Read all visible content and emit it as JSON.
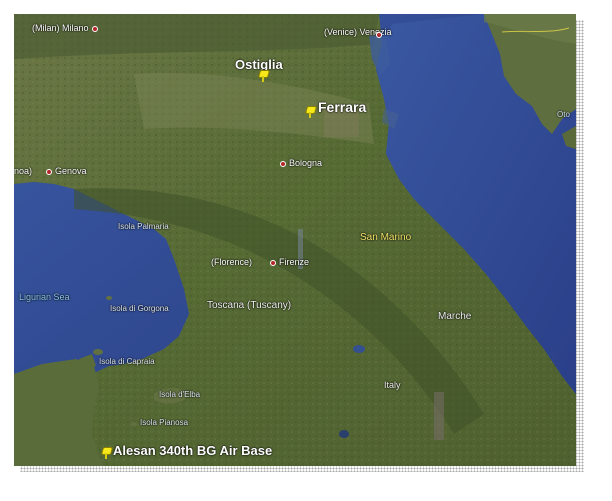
{
  "labels": {
    "milan": "(Milan)  Milano",
    "venice": "(Venice)  Venezia",
    "ostiglia": "Ostiglia",
    "ferrara": "Ferrara",
    "genova_prefix": "noa)",
    "genova": "Genova",
    "bologna": "Bologna",
    "oto": "Oto",
    "isola_palmaria": "Isola Palmaria",
    "san_marino": "San Marino",
    "florence": "(Florence)",
    "firenze": "Firenze",
    "ligurian_sea": "Ligurian Sea",
    "isola_gorgona": "Isola di Gorgona",
    "toscana": "Toscana (Tuscany)",
    "marche": "Marche",
    "isola_capraia": "Isola di Capraia",
    "isola_elba": "Isola d'Elba",
    "italy": "Italy",
    "isola_pianosa": "Isola Pianosa",
    "alesan": "Alesan 340th BG Air Base"
  },
  "colors": {
    "sea": "#2f4790",
    "land": "#5f6f3c",
    "placemark": "#f7e81c",
    "city_dot": "#b3262a"
  },
  "placemarks": [
    "ostiglia",
    "ferrara",
    "alesan"
  ],
  "icons": [
    "pushpin-icon",
    "city-dot-icon"
  ]
}
